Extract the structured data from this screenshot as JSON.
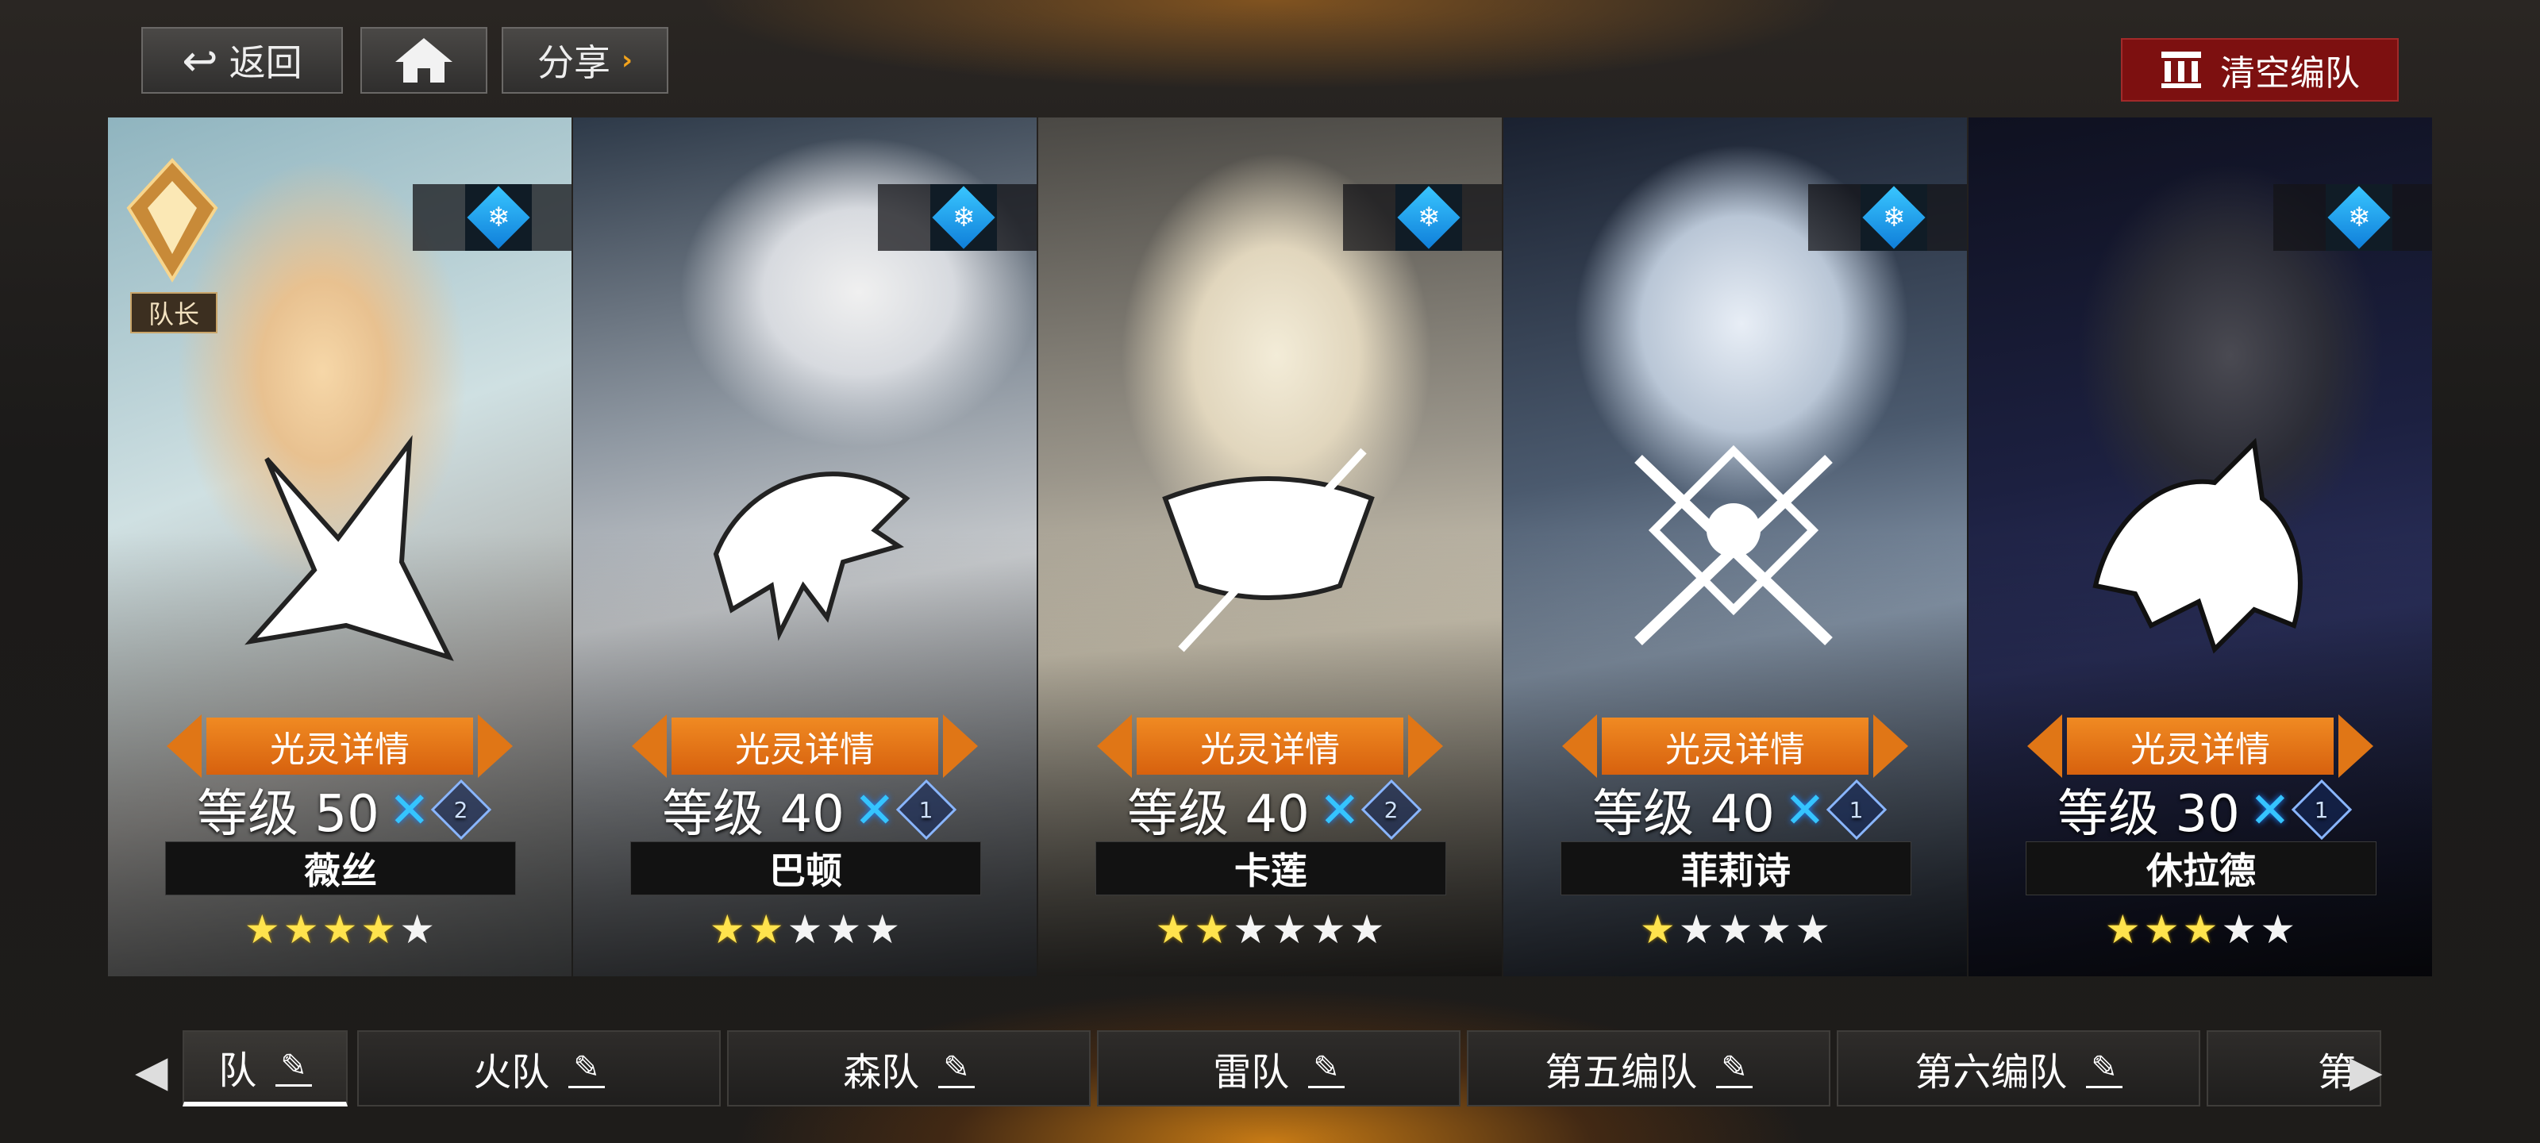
{
  "topbar": {
    "back_label": "返回",
    "share_label": "分享",
    "clear_label": "清空编队"
  },
  "cards": [
    {
      "name": "薇丝",
      "level_text": "等级 50",
      "rank": "2",
      "detail_label": "光灵详情",
      "stars_on": 4,
      "stars_total": 5,
      "captain": true,
      "captain_label": "队长",
      "accent": "#cfe6ee"
    },
    {
      "name": "巴顿",
      "level_text": "等级 40",
      "rank": "1",
      "detail_label": "光灵详情",
      "stars_on": 2,
      "stars_total": 5,
      "captain": false,
      "accent": "#d9dde2"
    },
    {
      "name": "卡莲",
      "level_text": "等级 40",
      "rank": "2",
      "detail_label": "光灵详情",
      "stars_on": 2,
      "stars_total": 6,
      "captain": false,
      "accent": "#e4dcc8"
    },
    {
      "name": "菲莉诗",
      "level_text": "等级 40",
      "rank": "1",
      "detail_label": "光灵详情",
      "stars_on": 1,
      "stars_total": 5,
      "captain": false,
      "accent": "#c9d6e6"
    },
    {
      "name": "休拉德",
      "level_text": "等级 30",
      "rank": "1",
      "detail_label": "光灵详情",
      "stars_on": 3,
      "stars_total": 5,
      "captain": false,
      "accent": "#2a2f44"
    }
  ],
  "element_icon": "snowflake-icon",
  "tabs": [
    {
      "label": "队"
    },
    {
      "label": "火队"
    },
    {
      "label": "森队"
    },
    {
      "label": "雷队"
    },
    {
      "label": "第五编队"
    },
    {
      "label": "第六编队"
    },
    {
      "label": "第"
    }
  ],
  "colors": {
    "detail_orange": "#e07616",
    "clear_red": "#7d1010",
    "ice_blue": "#35c4ff"
  }
}
